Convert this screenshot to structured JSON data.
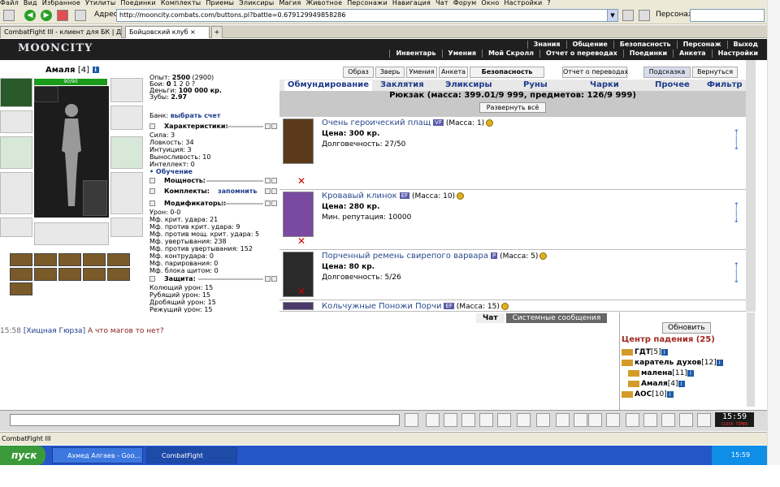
{
  "browser": {
    "menu": [
      "Файл",
      "Вид",
      "Избранное",
      "Утилиты",
      "Поединки",
      "Комплекты",
      "Приемы",
      "Эликсиры",
      "Магия",
      "Животное",
      "Персонажи",
      "Навигация",
      "Чат",
      "Форум",
      "Окно",
      "Настройки",
      "?"
    ],
    "address_label": "Адрес:",
    "address": "http://mooncity.combats.com/buttons.pl?battle=0.679129949858286",
    "persona_label": "Персонаж:",
    "tabs": [
      "CombatFight III - клиент для БК | До...",
      "Бойцовский клуб"
    ]
  },
  "site": {
    "logo": "MOONCITY",
    "top_links": [
      "Знания",
      "Общение",
      "Безопасность",
      "Персонаж",
      "Выход"
    ],
    "sub_links": [
      "Инвентарь",
      "Умения",
      "Мой Скролл",
      "Отчет о переводах",
      "Поединки",
      "Анкета",
      "Настройки"
    ]
  },
  "character": {
    "name": "Амаля",
    "level": "[4]",
    "level_badge": "i",
    "hp_label": "90/90",
    "hp_fraction": 1.0,
    "stats": [
      {
        "label": "Опыт:",
        "value": "2500",
        "extra": "(2900)"
      },
      {
        "label": "Бои:",
        "value": "0",
        "extra": "1 2  0 ?"
      },
      {
        "label": "Деньги:",
        "value": "100 000 кр."
      },
      {
        "label": "Зубы:",
        "value": "2.97"
      }
    ],
    "bank_label": "Банк:",
    "bank_link": "выбрать счет",
    "characteristics_title": "Характеристики:",
    "characteristics": [
      "Сила: 3",
      "Ловкость: 34",
      "Интуиция: 3",
      "Выносливость: 10",
      "Интеллект: 0"
    ],
    "training_link": "• Обучение",
    "power_title": "Мощность:",
    "sets_title": "Комплекты:",
    "sets_link": "запомнить",
    "modifiers_title": "Модификаторы:",
    "modifiers": [
      "Урон: 0-0",
      "Мф. крит. удара: 21",
      "Мф. против крит. удара: 9",
      "Мф. против мощ. крит. удара: 5",
      "Мф. увертывания: 238",
      "Мф. против увертывания: 152",
      "Мф. контрудара: 0",
      "Мф. парирования: 0",
      "Мф. блока щитом: 0"
    ],
    "defense_title": "Защита:",
    "defense": [
      "Колющий урон: 15",
      "Рубящий урон: 15",
      "Дробящий урон: 15",
      "Режущий урон: 15"
    ]
  },
  "inventory": {
    "toolbar": [
      "Образ",
      "Зверь",
      "Умения",
      "Анкета",
      "Безопасность",
      "Отчет о переводах",
      "Подсказка",
      "Вернуться"
    ],
    "categories": [
      "Обмундирование",
      "Заклятия",
      "Эликсиры",
      "Руны",
      "Чарки",
      "Прочее",
      "Фильтр"
    ],
    "backpack_title": "Рюкзак (масса: 399.01/9 999, предметов: 126/9 999)",
    "expand_label": "Развернуть всё",
    "items": [
      {
        "name": "Очень героический плащ",
        "tag": "VF",
        "mass": "(Масса: 1)",
        "line1": "Цена: 300 кр.",
        "line2": "Долговечность: 27/50",
        "color": "#5a3a1a"
      },
      {
        "name": "Кровавый клинок",
        "tag": "EF",
        "mass": "(Масса: 10)",
        "line1": "Цена: 280 кр.",
        "line2": "Мин. репутация:  10000",
        "color": "#7a4aa0"
      },
      {
        "name": "Порченный ремень свирепого варвара",
        "tag": "P",
        "mass": "(Масса: 5)",
        "line1": "Цена: 80 кр.",
        "line2": "Долговечность: 5/26",
        "color": "#2a2a2a"
      },
      {
        "name": "Кольчужные Поножи Порчи",
        "tag": "EF",
        "mass": "(Масса: 15)",
        "line1": "",
        "line2": "",
        "color": "#4a3a6a"
      }
    ]
  },
  "chat": {
    "tabs": [
      "Чат",
      "Системные сообщения"
    ],
    "time": "15:58",
    "author": "[Хищная Гюрза]",
    "message": "А что магов то нет?"
  },
  "room": {
    "refresh": "Обновить",
    "title": "Центр падения (25)",
    "users": [
      {
        "name": "ГДТ",
        "lvl": "[5]"
      },
      {
        "name": "каратель духов",
        "lvl": "[12]"
      },
      {
        "name": "малена",
        "lvl": "[11]"
      },
      {
        "name": "Амаля",
        "lvl": "[4]"
      },
      {
        "name": "АОС",
        "lvl": "[10]"
      }
    ]
  },
  "clock": {
    "time": "15:59",
    "label": "CLOCK TIMER"
  },
  "status": "CombatFight III",
  "taskbar": {
    "start": "пуск",
    "tasks": [
      "Ахмед Алгаев - Goo...",
      "CombatFight"
    ],
    "time": "15:59"
  }
}
